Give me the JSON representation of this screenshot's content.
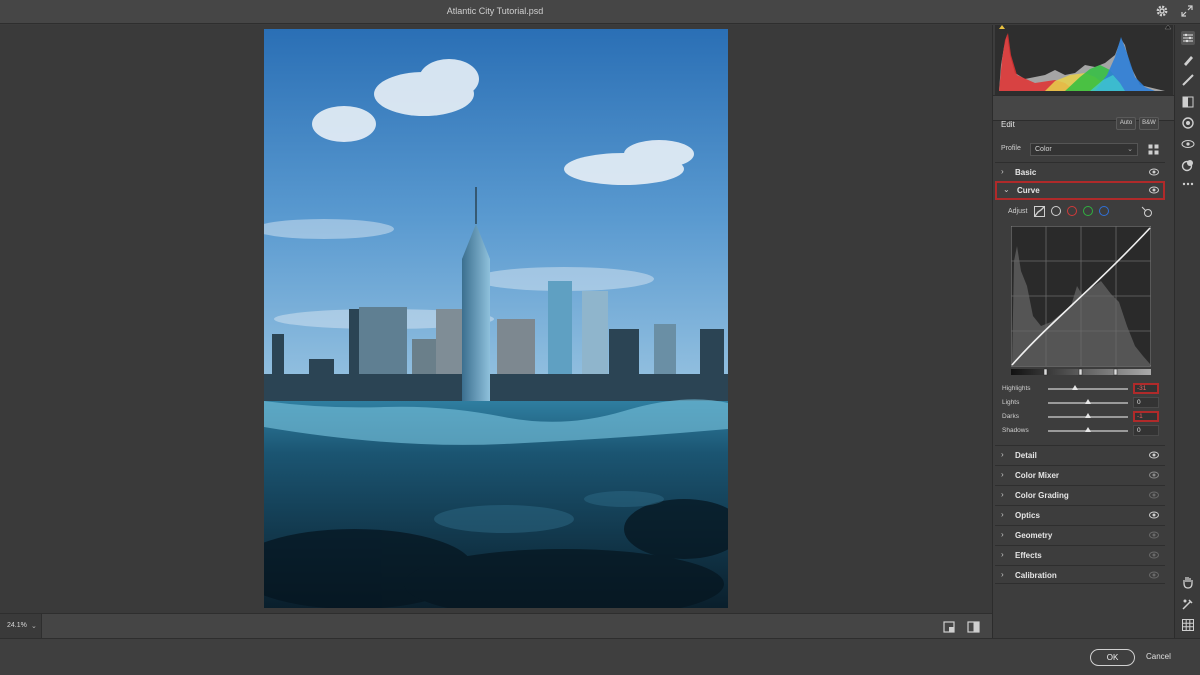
{
  "window": {
    "title": "Atlantic City Tutorial.psd"
  },
  "canvas": {
    "zoom": "24.1%"
  },
  "footer": {
    "ok": "OK",
    "cancel": "Cancel"
  },
  "edit": {
    "label": "Edit",
    "auto": "Auto",
    "bw": "B&W",
    "profile_label": "Profile",
    "profile_value": "Color"
  },
  "sections": [
    {
      "name": "Basic",
      "expanded": false
    },
    {
      "name": "Curve",
      "expanded": true,
      "highlighted": true
    },
    {
      "name": "Detail",
      "expanded": false
    },
    {
      "name": "Color Mixer",
      "expanded": false
    },
    {
      "name": "Color Grading",
      "expanded": false
    },
    {
      "name": "Optics",
      "expanded": false
    },
    {
      "name": "Geometry",
      "expanded": false
    },
    {
      "name": "Effects",
      "expanded": false
    },
    {
      "name": "Calibration",
      "expanded": false
    }
  ],
  "curve": {
    "adjust_label": "Adjust",
    "channels": [
      "parametric",
      "point",
      "red",
      "green",
      "blue"
    ],
    "sliders": [
      {
        "label": "Highlights",
        "value": "-31",
        "level": -31,
        "highlighted": true
      },
      {
        "label": "Lights",
        "value": "0",
        "level": 0,
        "highlighted": false
      },
      {
        "label": "Darks",
        "value": "-1",
        "level": -1,
        "highlighted": true
      },
      {
        "label": "Shadows",
        "value": "0",
        "level": 0,
        "highlighted": false
      }
    ]
  },
  "colors": {
    "accent_highlight": "#b02a2a",
    "panel_bg": "#3d3d3d",
    "hist_red": "#e03030",
    "hist_green": "#30c040",
    "hist_blue": "#2f7fd8",
    "hist_yellow": "#e8d04a",
    "hist_cyan": "#40c8d0"
  },
  "icons": {
    "titlebar": [
      "gear-icon",
      "expand-icon"
    ],
    "tools": [
      "edit-sliders-icon",
      "brush-icon",
      "heal-icon",
      "gradient-mask-icon",
      "radial-mask-icon",
      "redeye-icon",
      "presets-icon",
      "more-icon",
      "hand-icon",
      "sampler-icon",
      "grid-icon"
    ]
  }
}
